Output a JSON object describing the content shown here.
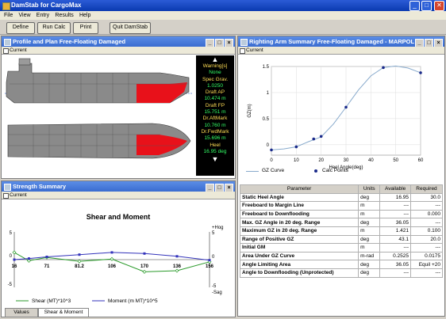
{
  "window": {
    "title": "DamStab for CargoMax",
    "min": "_",
    "max": "□",
    "close": "✕"
  },
  "menu": [
    "File",
    "View",
    "Entry",
    "Results",
    "Help"
  ],
  "toolbar": {
    "define": "Define",
    "run": "Run Calc",
    "print": "Print",
    "quit": "Quit DamStab"
  },
  "profile": {
    "title": "Profile and Plan Free-Floating Damaged",
    "sub": "Current",
    "readouts": [
      {
        "label": "Warning[s]",
        "value": "None",
        "cls": "v"
      },
      {
        "label": "Spec Grav.",
        "value": "1.0250",
        "cls": "v"
      },
      {
        "label": "Draft AP",
        "value": "10.474 m",
        "cls": "v"
      },
      {
        "label": "Draft FP",
        "value": "15.751 m",
        "cls": "v"
      },
      {
        "label": "Dr.AftMark",
        "value": "10.760 m",
        "cls": "v"
      },
      {
        "label": "Dr.FwdMark",
        "value": "15.696 m",
        "cls": "v"
      },
      {
        "label": "Heel",
        "value": "16.95 deg",
        "cls": "v"
      }
    ]
  },
  "strength": {
    "title": "Strength Summary",
    "sub": "Current",
    "tabs": [
      "Values",
      "Shear & Moment"
    ]
  },
  "righting": {
    "title": "Righting Arm Summary Free-Floating Damaged - MARPOL",
    "sub": "Current"
  },
  "chart_data": [
    {
      "type": "line",
      "title": "",
      "xlabel": "Heel Angle(deg)",
      "ylabel": "GZ(m)",
      "xlim": [
        0,
        60
      ],
      "ylim": [
        -0.2,
        1.5
      ],
      "xticks": [
        0,
        10,
        20,
        30,
        40,
        50,
        60
      ],
      "yticks": [
        0,
        0.5,
        1,
        1.5
      ],
      "series": [
        {
          "name": "GZ Curve",
          "x": [
            0,
            5,
            10,
            15,
            20,
            25,
            30,
            35,
            40,
            45,
            50,
            55,
            60
          ],
          "y": [
            -0.1,
            -0.08,
            -0.04,
            0.06,
            0.15,
            0.4,
            0.72,
            1.05,
            1.32,
            1.48,
            1.51,
            1.47,
            1.38
          ]
        },
        {
          "name": "Calc Points",
          "x": [
            0,
            10,
            17,
            20,
            30,
            45,
            60
          ],
          "y": [
            -0.1,
            -0.04,
            0.11,
            0.16,
            0.72,
            1.48,
            1.38
          ]
        }
      ],
      "legend": "bottom"
    },
    {
      "type": "line",
      "title": "Shear and Moment",
      "xticks": [
        "16",
        "71",
        "81.2",
        "106",
        "170",
        "136",
        "156"
      ],
      "ylim": [
        -5,
        5
      ],
      "left_ticks": [
        "5",
        "0",
        "-5"
      ],
      "right_labels": {
        "top": "+Hog",
        "top_val": "5",
        "mid": "0",
        "bot_val": "-5",
        "bot": "-Sag"
      },
      "series": [
        {
          "name": "Shear (MT)*10^3",
          "color": "#2a9a2a",
          "x": [
            16,
            40,
            71,
            81.2,
            106,
            120,
            136,
            156
          ],
          "y": [
            1.3,
            -0.2,
            0.4,
            -0.3,
            0.1,
            -2.2,
            -2.0,
            -0.4
          ]
        },
        {
          "name": "Moment (m MT)*10^5",
          "color": "#3333bb",
          "x": [
            16,
            40,
            71,
            81.2,
            106,
            120,
            136,
            156
          ],
          "y": [
            0.0,
            0.2,
            0.5,
            0.9,
            1.3,
            1.1,
            0.6,
            -0.1
          ]
        }
      ]
    }
  ],
  "gz_legend": {
    "curve": "GZ Curve",
    "points": "Calc Points"
  },
  "params": {
    "headers": [
      "Parameter",
      "Units",
      "Available",
      "Required"
    ],
    "rows": [
      [
        "Static Heel Angle",
        "deg",
        "16.95",
        "30.0"
      ],
      [
        "Freeboard to Margin Line",
        "m",
        "---",
        "---"
      ],
      [
        "Freeboard to Downflooding",
        "m",
        "---",
        "0.000"
      ],
      [
        "Max. GZ Angle in 20 deg. Range",
        "deg",
        "36.05",
        "---"
      ],
      [
        "Maximum GZ in 20 deg. Range",
        "m",
        "1.421",
        "0.100"
      ],
      [
        "Range of Positive GZ",
        "deg",
        "43.1",
        "20.0"
      ],
      [
        "Initial GM",
        "m",
        "---",
        "---"
      ],
      [
        "Area Under GZ Curve",
        "m-rad",
        "0.2525",
        "0.0175"
      ],
      [
        "Angle Limiting Area",
        "deg",
        "36.05",
        "Equil +20"
      ],
      [
        "Angle to Downflooding (Unprotected)",
        "deg",
        "---",
        "---"
      ]
    ]
  }
}
